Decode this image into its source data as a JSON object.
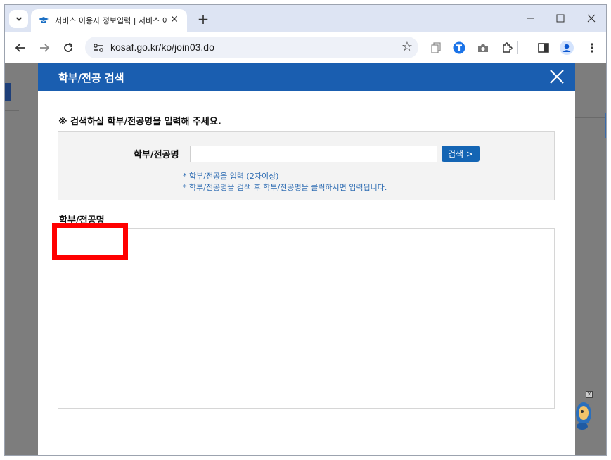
{
  "browser": {
    "tab_title": "서비스 이용자 정보입력 | 서비스 이용",
    "url": "kosaf.go.kr/ko/join03.do"
  },
  "modal": {
    "title": "학부/전공 검색",
    "instruction": "※ 검색하실 학부/전공명을 입력해 주세요.",
    "search_label": "학부/전공명",
    "search_value": "",
    "search_button": "검색 >",
    "hints": [
      "* 학부/전공을 입력 (2자이상)",
      "* 학부/전공명을 검색 후 학부/전공명을 클릭하시면 입력됩니다."
    ],
    "result_label": "학부/전공명"
  },
  "colors": {
    "header_blue": "#1a5eb0",
    "button_blue": "#1465b4",
    "hint_blue": "#2f6db3",
    "highlight_red": "#ff0000"
  }
}
